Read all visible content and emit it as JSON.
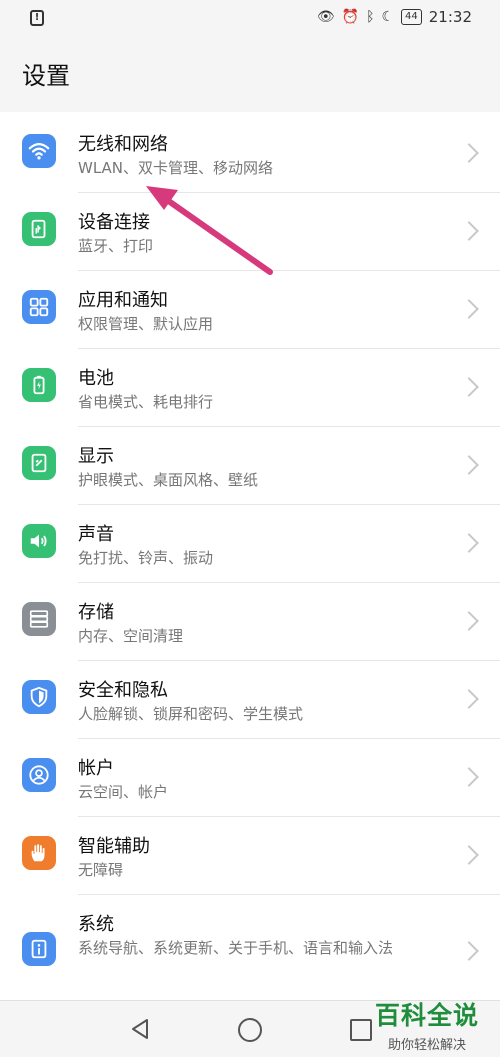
{
  "statusbar": {
    "battery": "44",
    "time": "21:32"
  },
  "header": {
    "title": "设置"
  },
  "items": [
    {
      "title": "无线和网络",
      "subtitle": "WLAN、双卡管理、移动网络",
      "icon": "wifi-icon",
      "color": "#4a8ff0"
    },
    {
      "title": "设备连接",
      "subtitle": "蓝牙、打印",
      "icon": "device-connection-icon",
      "color": "#35c073"
    },
    {
      "title": "应用和通知",
      "subtitle": "权限管理、默认应用",
      "icon": "apps-grid-icon",
      "color": "#4a8ff0"
    },
    {
      "title": "电池",
      "subtitle": "省电模式、耗电排行",
      "icon": "battery-icon",
      "color": "#35c073"
    },
    {
      "title": "显示",
      "subtitle": "护眼模式、桌面风格、壁纸",
      "icon": "display-icon",
      "color": "#35c073"
    },
    {
      "title": "声音",
      "subtitle": "免打扰、铃声、振动",
      "icon": "speaker-icon",
      "color": "#35c073"
    },
    {
      "title": "存储",
      "subtitle": "内存、空间清理",
      "icon": "storage-icon",
      "color": "#8a8f96"
    },
    {
      "title": "安全和隐私",
      "subtitle": "人脸解锁、锁屏和密码、学生模式",
      "icon": "shield-icon",
      "color": "#4a8ff0"
    },
    {
      "title": "帐户",
      "subtitle": "云空间、帐户",
      "icon": "account-icon",
      "color": "#4a8ff0"
    },
    {
      "title": "智能辅助",
      "subtitle": "无障碍",
      "icon": "hand-icon",
      "color": "#f07d2e"
    },
    {
      "title": "系统",
      "subtitle": "系统导航、系统更新、关于手机、语言和输入法",
      "icon": "system-info-icon",
      "color": "#4a8ff0"
    }
  ],
  "watermark": {
    "main": "百科全说",
    "sub": "助你轻松解决"
  },
  "annotation_color": "#d63a7c"
}
